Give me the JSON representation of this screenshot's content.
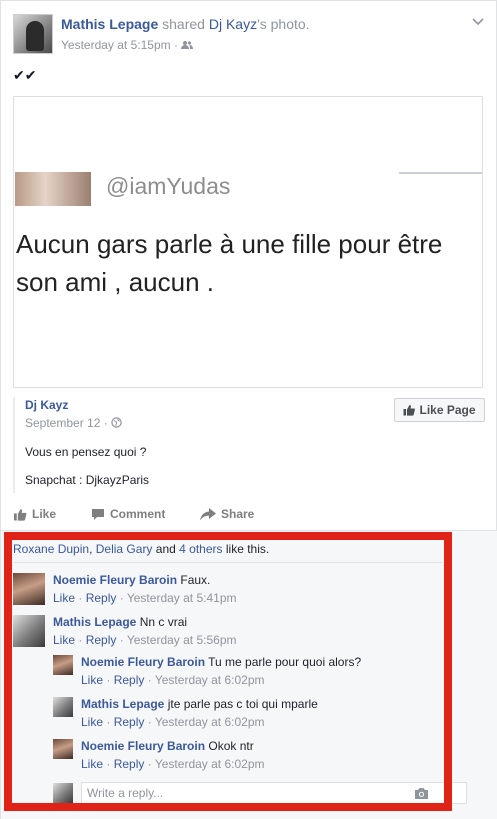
{
  "post": {
    "author": "Mathis Lepage",
    "shared_text": "shared",
    "source_owner": "Dj Kayz",
    "source_suffix": "'s photo.",
    "timestamp": "Yesterday at 5:15pm",
    "separator": "·",
    "status_text": "✔✔",
    "icons": {
      "audience": "friends-icon",
      "menu": "chevron-down-icon"
    }
  },
  "shared_image": {
    "handle": "@iamYudas",
    "text": "Aucun gars parle à une fille pour être son ami , aucun ."
  },
  "attribution": {
    "page_name": "Dj Kayz",
    "date": "September 12",
    "separator": "·",
    "line1": "Vous en pensez quoi ?",
    "line2": "Snapchat : DjkayzParis",
    "like_page_label": "Like Page"
  },
  "actions": {
    "like": "Like",
    "comment": "Comment",
    "share": "Share"
  },
  "likes": {
    "name1": "Roxane Dupin",
    "comma": ",",
    "name2": "Delia Gary",
    "and_text": "and",
    "others": "4 others",
    "suffix": "like this."
  },
  "comments": [
    {
      "author": "Noemie Fleury Baroin",
      "text": "Faux.",
      "like": "Like",
      "reply": "Reply",
      "sep": "·",
      "time": "Yesterday at 5:41pm"
    },
    {
      "author": "Mathis Lepage",
      "text": "Nn c vrai",
      "like": "Like",
      "reply": "Reply",
      "sep": "·",
      "time": "Yesterday at 5:56pm"
    }
  ],
  "replies": [
    {
      "author": "Noemie Fleury Baroin",
      "text": "Tu me parle pour quoi alors?",
      "like": "Like",
      "reply": "Reply",
      "sep": "·",
      "time": "Yesterday at 6:02pm"
    },
    {
      "author": "Mathis Lepage",
      "text": "jte parle pas c toi qui mparle",
      "like": "Like",
      "reply": "Reply",
      "sep": "·",
      "time": "Yesterday at 6:02pm"
    },
    {
      "author": "Noemie Fleury Baroin",
      "text": "Okok ntr",
      "like": "Like",
      "reply": "Reply",
      "sep": "·",
      "time": "Yesterday at 6:02pm"
    }
  ],
  "reply_box": {
    "placeholder": "Write a reply..."
  },
  "colors": {
    "link": "#3b5998",
    "meta": "#90949c",
    "highlight_frame": "#e02317"
  }
}
